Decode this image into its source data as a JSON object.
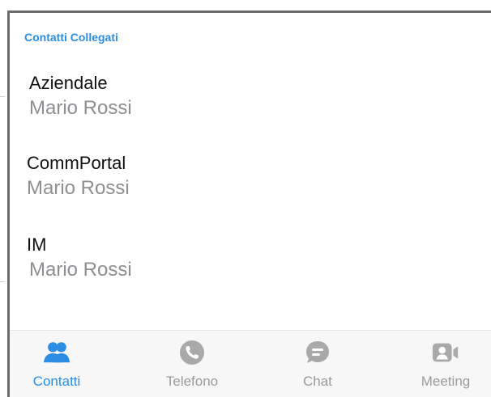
{
  "section": {
    "title": "Contatti Collegati"
  },
  "contacts": [
    {
      "source": "Aziendale",
      "name": "Mario Rossi"
    },
    {
      "source": "CommPortal",
      "name": "Mario Rossi"
    },
    {
      "source": "IM",
      "name": "Mario Rossi"
    }
  ],
  "tabbar": {
    "tabs": [
      {
        "label": "Contatti",
        "icon": "contacts-icon",
        "active": true
      },
      {
        "label": "Telefono",
        "icon": "phone-icon",
        "active": false
      },
      {
        "label": "Chat",
        "icon": "chat-icon",
        "active": false
      },
      {
        "label": "Meeting",
        "icon": "meeting-icon",
        "active": false
      }
    ]
  },
  "colors": {
    "accent": "#2b8de3",
    "inactive": "#9b9b9b",
    "secondary_text": "#8e8e93"
  }
}
